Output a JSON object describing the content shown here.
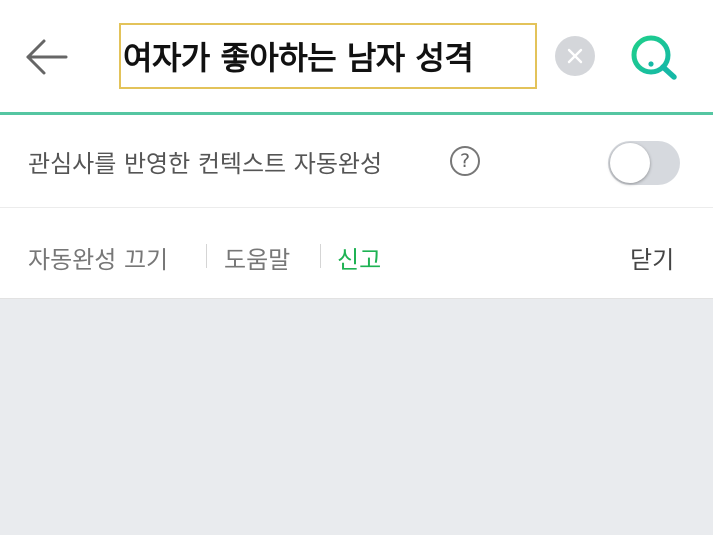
{
  "search": {
    "query": "여자가 좋아하는 남자 성격"
  },
  "settings": {
    "autocomplete_label": "관심사를 반영한 컨텍스트 자동완성",
    "help_symbol": "?",
    "toggle_on": false
  },
  "footer": {
    "disable_autocomplete": "자동완성 끄기",
    "help": "도움말",
    "report": "신고",
    "close": "닫기"
  },
  "colors": {
    "accent_green": "#1eb253",
    "search_border": "#e3c35a",
    "divider": "#55c6a2",
    "background": "#e9ebee"
  }
}
